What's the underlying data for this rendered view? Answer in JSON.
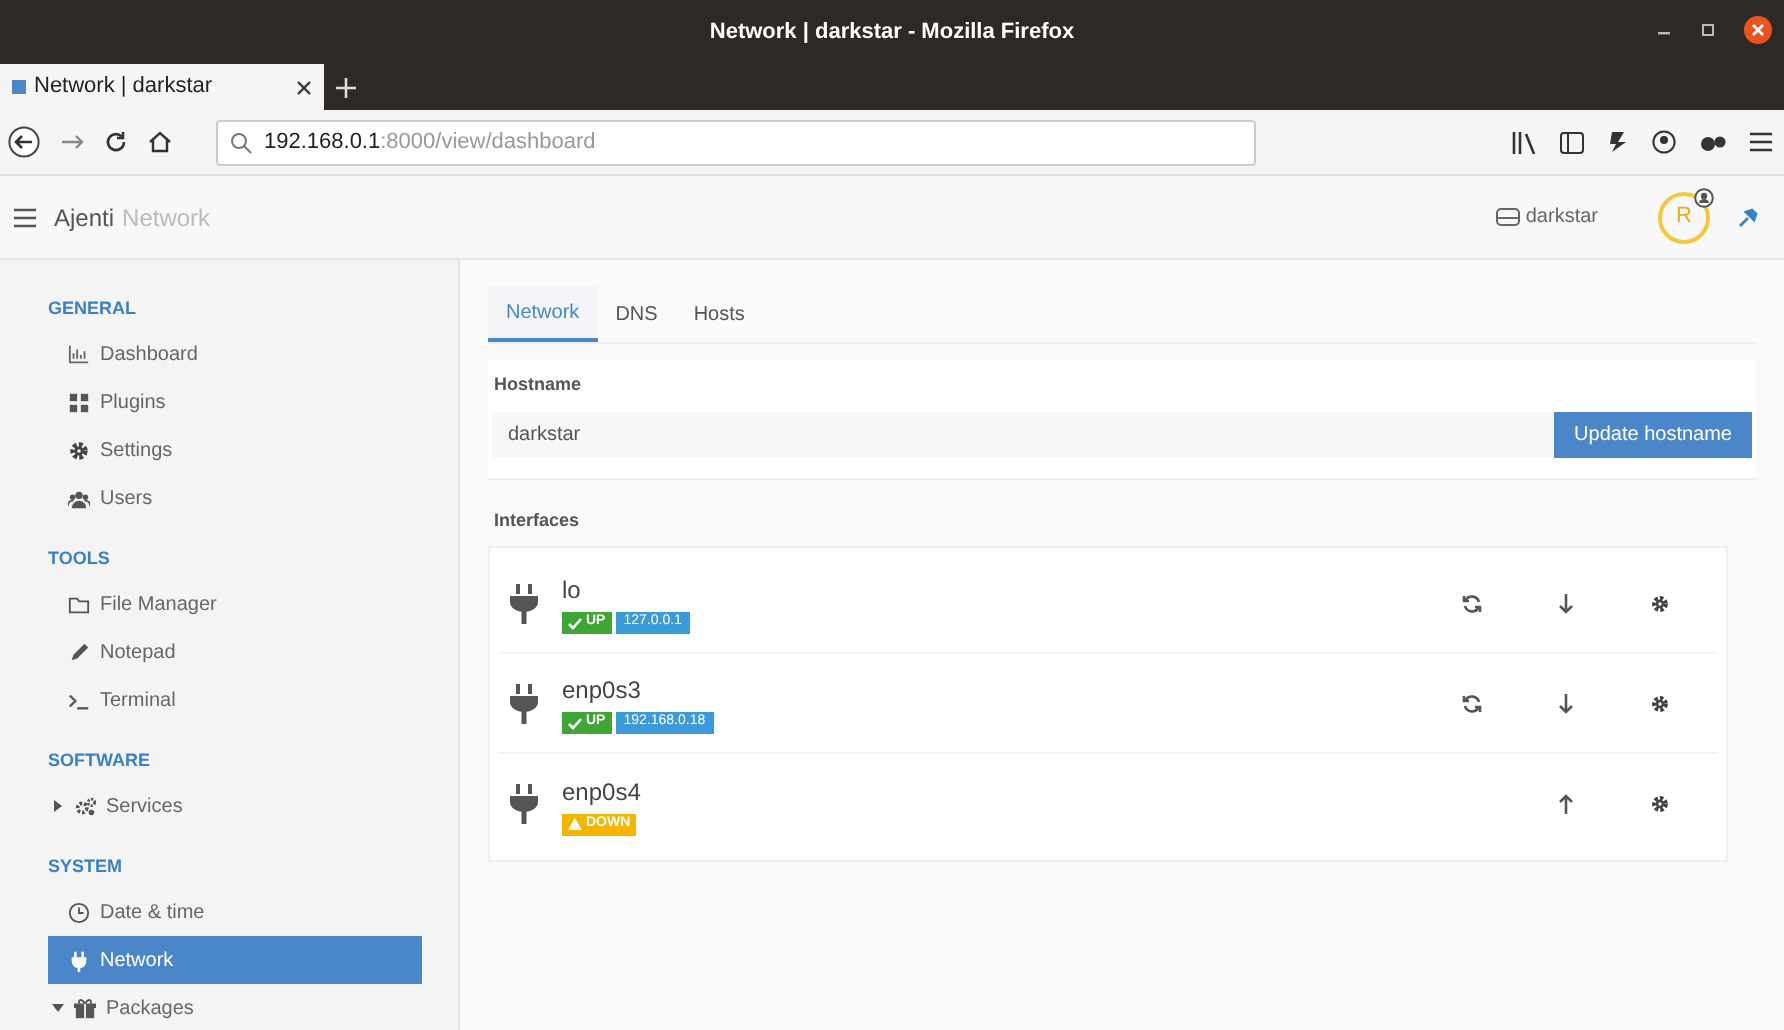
{
  "window": {
    "title": "Network | darkstar - Mozilla Firefox"
  },
  "browser_tab": {
    "label": "Network | darkstar",
    "selected": true
  },
  "address_bar": {
    "host": "192.168.0.1",
    "rest": ":8000/view/dashboard"
  },
  "app_header": {
    "brand": "Ajenti",
    "page": "Network",
    "server": "darkstar",
    "avatar": "R"
  },
  "sidebar": [
    {
      "heading": "GENERAL",
      "items": [
        {
          "label": "Dashboard",
          "kind": "link",
          "selected": false
        },
        {
          "label": "Plugins",
          "kind": "link",
          "selected": false
        },
        {
          "label": "Settings",
          "kind": "link",
          "selected": false
        },
        {
          "label": "Users",
          "kind": "link",
          "selected": false
        }
      ]
    },
    {
      "heading": "TOOLS",
      "items": [
        {
          "label": "File Manager",
          "kind": "link",
          "selected": false
        },
        {
          "label": "Notepad",
          "kind": "link",
          "selected": false
        },
        {
          "label": "Terminal",
          "kind": "link",
          "selected": false
        }
      ]
    },
    {
      "heading": "SOFTWARE",
      "items": [
        {
          "label": "Services",
          "kind": "group",
          "expanded": false,
          "selected": false
        }
      ]
    },
    {
      "heading": "SYSTEM",
      "items": [
        {
          "label": "Date & time",
          "kind": "link",
          "selected": false
        },
        {
          "label": "Network",
          "kind": "link",
          "selected": true
        },
        {
          "label": "Packages",
          "kind": "group",
          "expanded": true,
          "selected": false
        }
      ]
    }
  ],
  "tabs": [
    {
      "label": "Network",
      "selected": true
    },
    {
      "label": "DNS",
      "selected": false
    },
    {
      "label": "Hosts",
      "selected": false
    }
  ],
  "hostname": {
    "label": "Hostname",
    "value": "darkstar",
    "button": "Update hostname"
  },
  "interfaces": {
    "label": "Interfaces",
    "items": [
      {
        "name": "lo",
        "up": true,
        "status": "UP",
        "address": "127.0.0.1"
      },
      {
        "name": "enp0s3",
        "up": true,
        "status": "UP",
        "address": "192.168.0.18"
      },
      {
        "name": "enp0s4",
        "up": false,
        "status": "DOWN"
      }
    ]
  }
}
